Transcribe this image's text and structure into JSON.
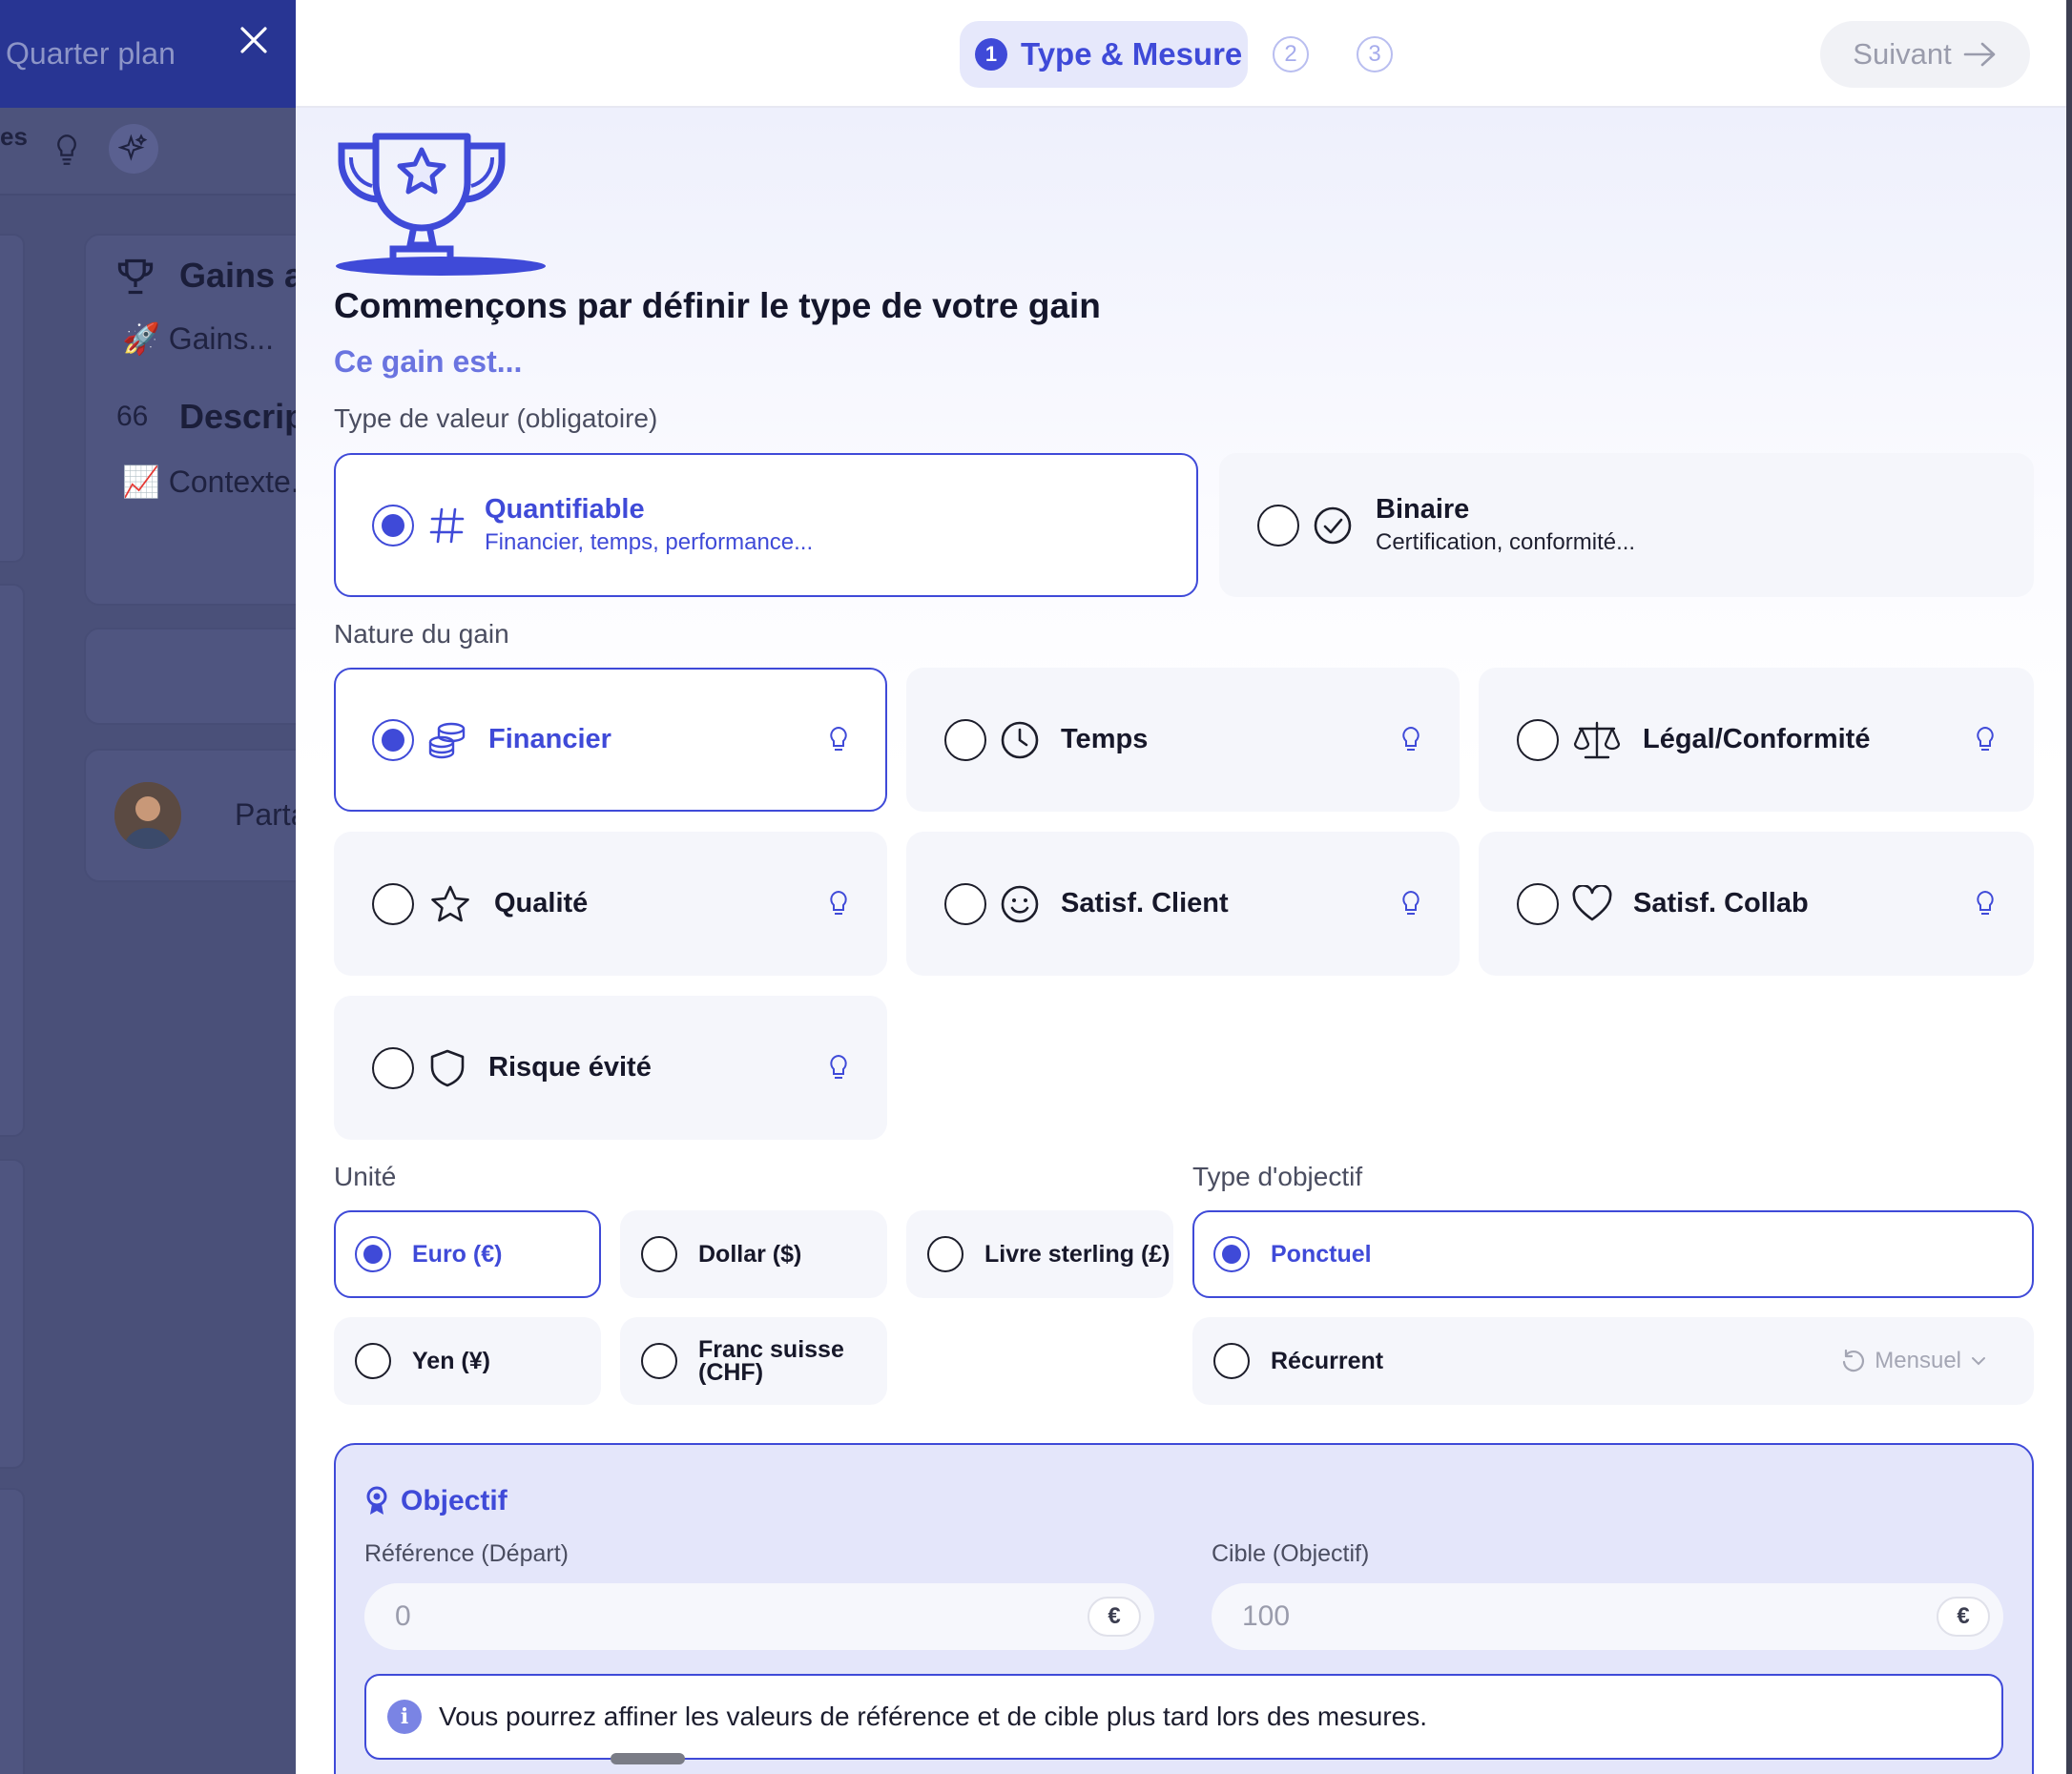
{
  "colors": {
    "accent": "#3f4ad8",
    "card": "#f5f6fb",
    "overlay": "#4a5079"
  },
  "background": {
    "title": "Quarter plan",
    "tab_fragment": "es",
    "gains_title": "Gains a",
    "gains_item": "🚀 Gains...",
    "desc_prefix": "66",
    "desc_title": "Descrip",
    "context_item": "📈 Contexte...",
    "share_fragment": "Parta"
  },
  "stepper": {
    "step1_number": "1",
    "step1_label": "Type & Mesure",
    "step2_number": "2",
    "step3_number": "3",
    "next_label": "Suivant"
  },
  "intro": {
    "headline": "Commençons par définir le type de votre gain",
    "subhead": "Ce gain est..."
  },
  "value_type": {
    "label": "Type de valeur (obligatoire)",
    "options": [
      {
        "title": "Quantifiable",
        "subtitle": "Financier, temps, performance...",
        "icon": "hash-icon",
        "selected": true
      },
      {
        "title": "Binaire",
        "subtitle": "Certification, conformité...",
        "icon": "check-circle-icon",
        "selected": false
      }
    ]
  },
  "nature": {
    "label": "Nature du gain",
    "options": [
      {
        "title": "Financier",
        "icon": "coins-icon",
        "selected": true
      },
      {
        "title": "Temps",
        "icon": "clock-icon",
        "selected": false
      },
      {
        "title": "Légal/Conformité",
        "icon": "scale-icon",
        "selected": false
      },
      {
        "title": "Qualité",
        "icon": "star-icon",
        "selected": false
      },
      {
        "title": "Satisf. Client",
        "icon": "smile-icon",
        "selected": false
      },
      {
        "title": "Satisf. Collab",
        "icon": "heart-icon",
        "selected": false
      },
      {
        "title": "Risque évité",
        "icon": "shield-icon",
        "selected": false
      }
    ]
  },
  "unit": {
    "label": "Unité",
    "options": [
      {
        "title": "Euro (€)",
        "selected": true
      },
      {
        "title": "Dollar ($)",
        "selected": false
      },
      {
        "title": "Livre sterling (£)",
        "selected": false
      },
      {
        "title": "Yen (¥)",
        "selected": false
      },
      {
        "title": "Franc suisse",
        "title2": "(CHF)",
        "selected": false
      }
    ]
  },
  "objective_type": {
    "label": "Type d'objectif",
    "options": [
      {
        "title": "Ponctuel",
        "selected": true
      },
      {
        "title": "Récurrent",
        "selected": false,
        "frequency": "Mensuel"
      }
    ]
  },
  "objectif": {
    "title": "Objectif",
    "reference_label": "Référence (Départ)",
    "reference_placeholder": "0",
    "target_label": "Cible (Objectif)",
    "target_placeholder": "100",
    "currency": "€",
    "info": "Vous pourrez affiner les valeurs de référence et de cible plus tard lors des mesures."
  }
}
